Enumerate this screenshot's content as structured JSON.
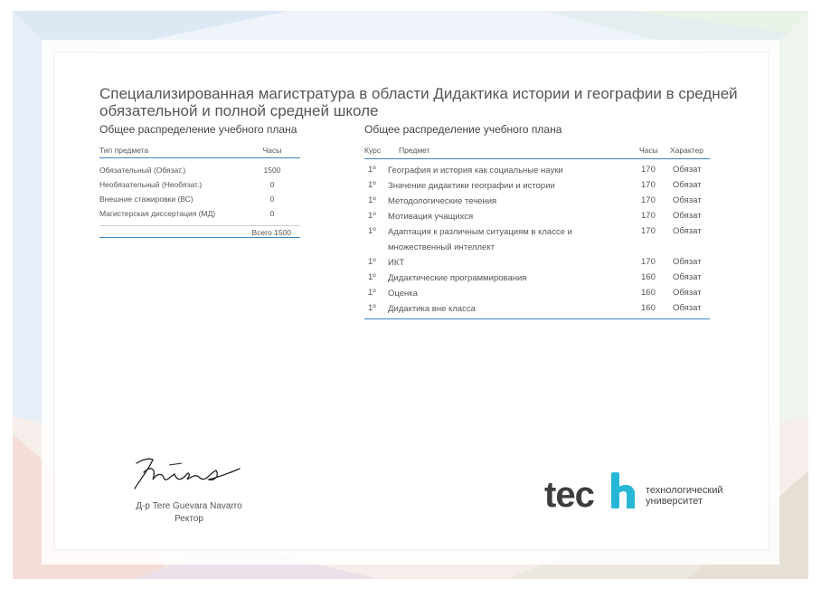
{
  "title": "Специализированная магистратура в области Дидактика истории и географии в средней обязательной и полной средней школе",
  "left_section": {
    "heading": "Общее распределение учебного плана",
    "columns": {
      "type": "Тип предмета",
      "hours": "Часы"
    },
    "rows": [
      {
        "type": "Обязательный (Обязат.)",
        "hours": "1500"
      },
      {
        "type": "Необязательный (Необязат.)",
        "hours": "0"
      },
      {
        "type": "Внешние стажировки (ВС)",
        "hours": "0"
      },
      {
        "type": "Магистерская диссертация (МД)",
        "hours": "0"
      }
    ],
    "total": "Всего 1500"
  },
  "right_section": {
    "heading": "Общее распределение учебного плана",
    "columns": {
      "course": "Курс",
      "subject": "Предмет",
      "hours": "Часы",
      "character": "Характер"
    },
    "rows": [
      {
        "course": "1º",
        "subject": "География и история как социальные науки",
        "hours": "170",
        "character": "Обязат"
      },
      {
        "course": "1º",
        "subject": "Значение дидактики географии и истории",
        "hours": "170",
        "character": "Обязат"
      },
      {
        "course": "1º",
        "subject": "Методологические течения",
        "hours": "170",
        "character": "Обязат"
      },
      {
        "course": "1º",
        "subject": "Мотивация учащихся",
        "hours": "170",
        "character": "Обязат"
      },
      {
        "course": "1º",
        "subject": "Адаптация к различным ситуациям в классе и множественный интеллект",
        "hours": "170",
        "character": "Обязат"
      },
      {
        "course": "1º",
        "subject": "ИКТ",
        "hours": "170",
        "character": "Обязат"
      },
      {
        "course": "1º",
        "subject": "Дидактические программирования",
        "hours": "160",
        "character": "Обязат"
      },
      {
        "course": "1º",
        "subject": "Оценка",
        "hours": "160",
        "character": "Обязат"
      },
      {
        "course": "1º",
        "subject": "Дидактика вне класса",
        "hours": "160",
        "character": "Обязат"
      }
    ]
  },
  "signatory": {
    "name": "Д-р Tere Guevara Navarro",
    "role": "Ректор"
  },
  "logo": {
    "wordmark": "tech",
    "line1": "технологический",
    "line2": "университет",
    "accent_color": "#27b7d6",
    "text_color": "#3d3d3d"
  }
}
